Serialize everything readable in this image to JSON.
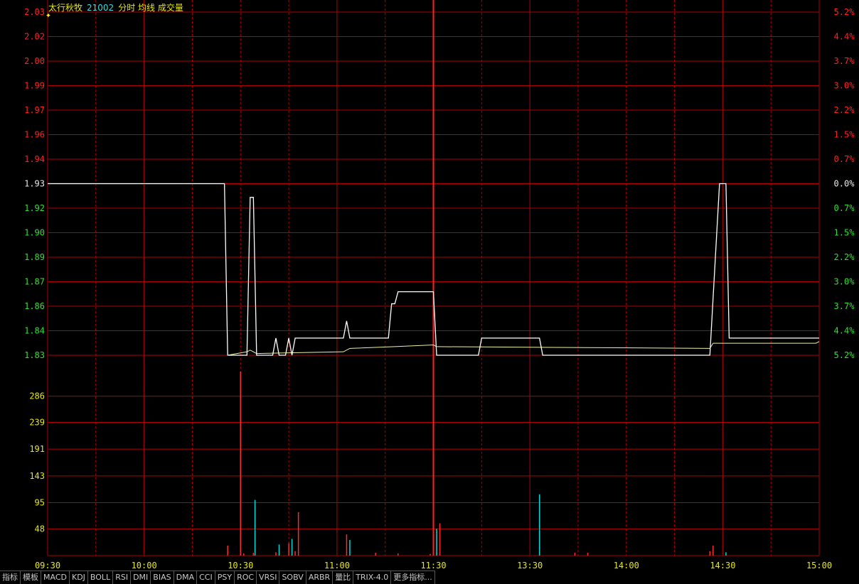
{
  "header": {
    "stock_name": "太行秋牧",
    "stock_code": "21002",
    "indicators": "分时 均线 成交量"
  },
  "colors": {
    "grid": "#b00000",
    "axis_up": "#ff2020",
    "axis_down": "#33dd33",
    "axis_flat": "#e8e8e8",
    "vol_axis": "#e8e800",
    "price_line": "#ffffff",
    "avg_line": "#f0f0a0",
    "vol_up": "#ff2a2a",
    "vol_down": "#00d8d8",
    "time_label": "#e8e800"
  },
  "chart_data": {
    "type": "line",
    "prev_close": 1.93,
    "price_axis": {
      "labels": [
        "2.03",
        "2.02",
        "2.00",
        "1.99",
        "1.97",
        "1.96",
        "1.94",
        "1.93",
        "1.92",
        "1.90",
        "1.89",
        "1.87",
        "1.86",
        "1.84",
        "1.83"
      ],
      "percent_labels": [
        "5.2%",
        "4.4%",
        "3.7%",
        "3.0%",
        "2.2%",
        "1.5%",
        "0.7%",
        "0.0%",
        "0.7%",
        "1.5%",
        "2.2%",
        "3.0%",
        "3.7%",
        "4.4%",
        "5.2%"
      ],
      "range": [
        1.83,
        2.03
      ]
    },
    "volume_axis": {
      "labels": [
        "286",
        "239",
        "191",
        "143",
        "95",
        "48"
      ],
      "range": [
        0,
        334
      ]
    },
    "x_labels": [
      "09:30",
      "10:00",
      "10:30",
      "11:00",
      "11:30",
      "13:30",
      "14:00",
      "14:30",
      "15:00"
    ],
    "minutes_total": 240,
    "price_series": [
      [
        0,
        1.93
      ],
      [
        55,
        1.93
      ],
      [
        56,
        1.83
      ],
      [
        62,
        1.83
      ],
      [
        63,
        1.922
      ],
      [
        64,
        1.922
      ],
      [
        65,
        1.83
      ],
      [
        70,
        1.83
      ],
      [
        71,
        1.84
      ],
      [
        72,
        1.83
      ],
      [
        74,
        1.83
      ],
      [
        75,
        1.84
      ],
      [
        76,
        1.83
      ],
      [
        77,
        1.84
      ],
      [
        92,
        1.84
      ],
      [
        93,
        1.85
      ],
      [
        94,
        1.84
      ],
      [
        106,
        1.84
      ],
      [
        107,
        1.86
      ],
      [
        108,
        1.86
      ],
      [
        109,
        1.867
      ],
      [
        120,
        1.867
      ],
      [
        121,
        1.83
      ],
      [
        134,
        1.83
      ],
      [
        135,
        1.84
      ],
      [
        153,
        1.84
      ],
      [
        154,
        1.83
      ],
      [
        206,
        1.83
      ],
      [
        209,
        1.93
      ],
      [
        211,
        1.93
      ],
      [
        212,
        1.84
      ],
      [
        240,
        1.84
      ]
    ],
    "avg_series": [
      [
        56,
        1.83
      ],
      [
        62,
        1.832
      ],
      [
        63,
        1.833
      ],
      [
        65,
        1.831
      ],
      [
        92,
        1.832
      ],
      [
        94,
        1.834
      ],
      [
        108,
        1.835
      ],
      [
        120,
        1.836
      ],
      [
        121,
        1.835
      ],
      [
        206,
        1.834
      ],
      [
        207,
        1.837
      ],
      [
        211,
        1.837
      ],
      [
        212,
        1.837
      ],
      [
        239,
        1.837
      ],
      [
        240,
        1.838
      ]
    ],
    "volume_bars": [
      {
        "m": 56,
        "v": 18,
        "dir": "up"
      },
      {
        "m": 60,
        "v": 330,
        "dir": "up"
      },
      {
        "m": 61,
        "v": 4,
        "dir": "up"
      },
      {
        "m": 64,
        "v": 5,
        "dir": "up"
      },
      {
        "m": 64.5,
        "v": 100,
        "dir": "down"
      },
      {
        "m": 71,
        "v": 6,
        "dir": "up"
      },
      {
        "m": 72,
        "v": 20,
        "dir": "down"
      },
      {
        "m": 75,
        "v": 22,
        "dir": "up"
      },
      {
        "m": 76,
        "v": 30,
        "dir": "down"
      },
      {
        "m": 77,
        "v": 8,
        "dir": "up"
      },
      {
        "m": 78,
        "v": 78,
        "dir": "up"
      },
      {
        "m": 93,
        "v": 38,
        "dir": "up"
      },
      {
        "m": 94,
        "v": 28,
        "dir": "down"
      },
      {
        "m": 102,
        "v": 5,
        "dir": "up"
      },
      {
        "m": 109,
        "v": 4,
        "dir": "up"
      },
      {
        "m": 119,
        "v": 3,
        "dir": "up"
      },
      {
        "m": 121,
        "v": 48,
        "dir": "down"
      },
      {
        "m": 122,
        "v": 58,
        "dir": "up"
      },
      {
        "m": 153,
        "v": 110,
        "dir": "down"
      },
      {
        "m": 164,
        "v": 5,
        "dir": "up"
      },
      {
        "m": 168,
        "v": 5,
        "dir": "up"
      },
      {
        "m": 206,
        "v": 8,
        "dir": "up"
      },
      {
        "m": 207,
        "v": 18,
        "dir": "up"
      },
      {
        "m": 211,
        "v": 6,
        "dir": "down"
      }
    ]
  },
  "toolbar": {
    "items": [
      "指标",
      "模板",
      "MACD",
      "KDJ",
      "BOLL",
      "RSI",
      "DMI",
      "BIAS",
      "DMA",
      "CCI",
      "PSY",
      "ROC",
      "VRSI",
      "SOBV",
      "ARBR",
      "量比",
      "TRIX-4.0",
      "更多指标..."
    ]
  }
}
